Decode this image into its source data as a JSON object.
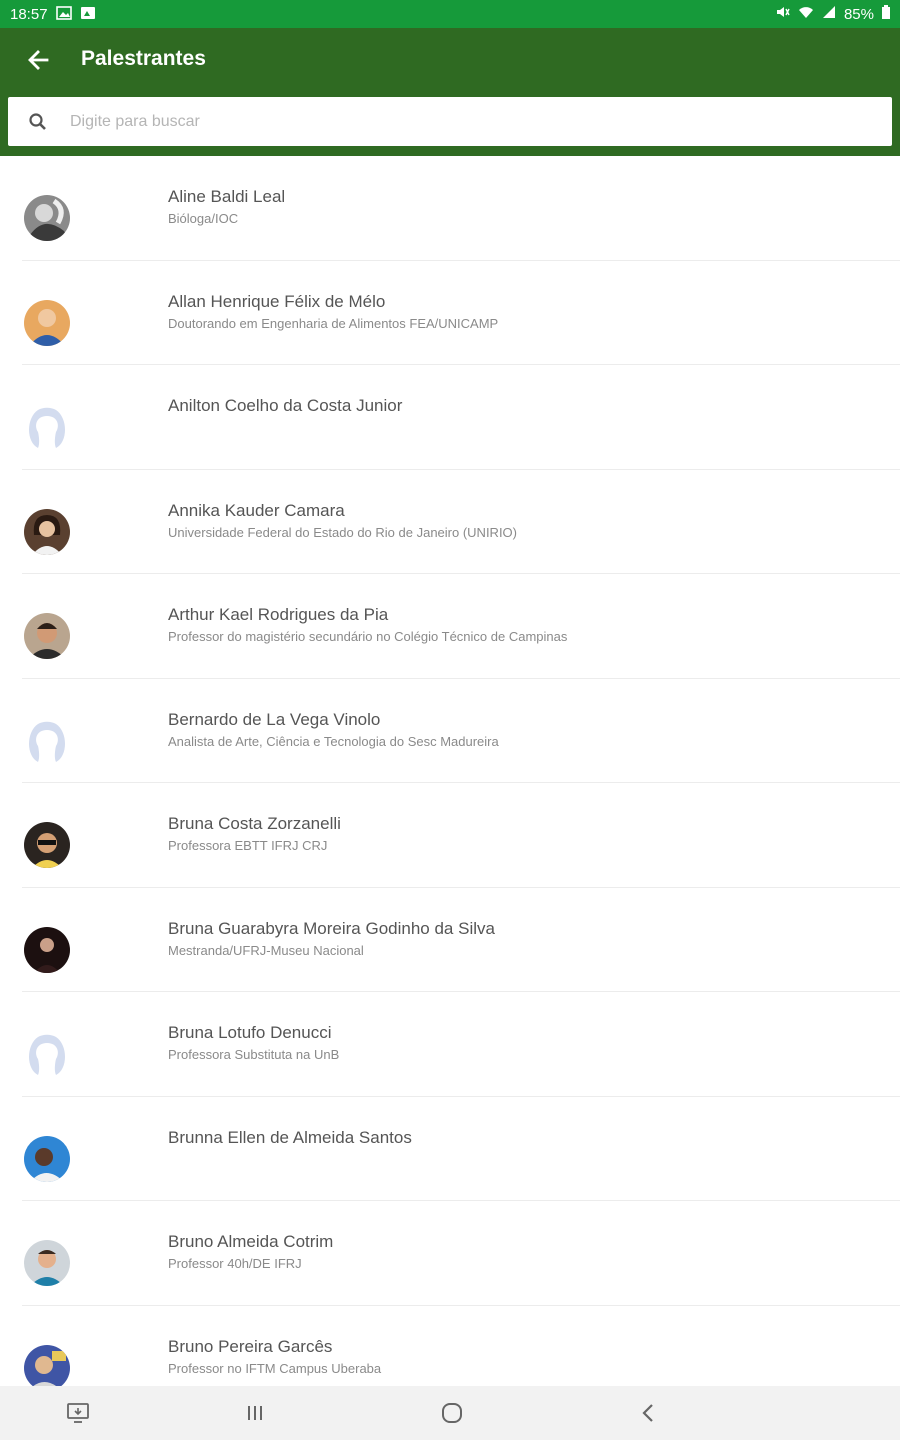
{
  "status_bar": {
    "time": "18:57",
    "battery": "85%"
  },
  "app_bar": {
    "title": "Palestrantes"
  },
  "search": {
    "placeholder": "Digite para buscar",
    "value": ""
  },
  "speakers": [
    {
      "name": "Aline Baldi Leal",
      "subtitle": "Bióloga/IOC"
    },
    {
      "name": "Allan Henrique Félix de Mélo",
      "subtitle": "Doutorando em Engenharia de Alimentos FEA/UNICAMP"
    },
    {
      "name": "Anilton Coelho da Costa Junior",
      "subtitle": ""
    },
    {
      "name": "Annika Kauder Camara",
      "subtitle": "Universidade Federal do Estado do Rio de Janeiro (UNIRIO)"
    },
    {
      "name": "Arthur Kael Rodrigues da Pia",
      "subtitle": "Professor do magistério secundário no Colégio Técnico de Campinas"
    },
    {
      "name": "Bernardo de La Vega Vinolo",
      "subtitle": "Analista de Arte, Ciência e Tecnologia do Sesc Madureira"
    },
    {
      "name": "Bruna Costa Zorzanelli",
      "subtitle": "Professora EBTT IFRJ CRJ"
    },
    {
      "name": "Bruna Guarabyra Moreira Godinho da Silva",
      "subtitle": "Mestranda/UFRJ-Museu Nacional"
    },
    {
      "name": "Bruna Lotufo Denucci",
      "subtitle": "Professora Substituta na UnB"
    },
    {
      "name": "Brunna Ellen de Almeida Santos",
      "subtitle": ""
    },
    {
      "name": "Bruno Almeida Cotrim",
      "subtitle": "Professor 40h/DE IFRJ"
    },
    {
      "name": "Bruno Pereira Garcês",
      "subtitle": "Professor no IFTM Campus Uberaba"
    }
  ],
  "avatar_icons": [
    "photo-avatar",
    "photo-avatar",
    "default-avatar",
    "photo-avatar",
    "photo-avatar",
    "default-avatar",
    "photo-avatar",
    "photo-avatar",
    "default-avatar",
    "photo-avatar",
    "photo-avatar",
    "photo-avatar"
  ],
  "colors": {
    "status_bar": "#169a3a",
    "app_bar": "#2f6a22",
    "text": "#555555",
    "subtitle": "#8a8a8a"
  }
}
